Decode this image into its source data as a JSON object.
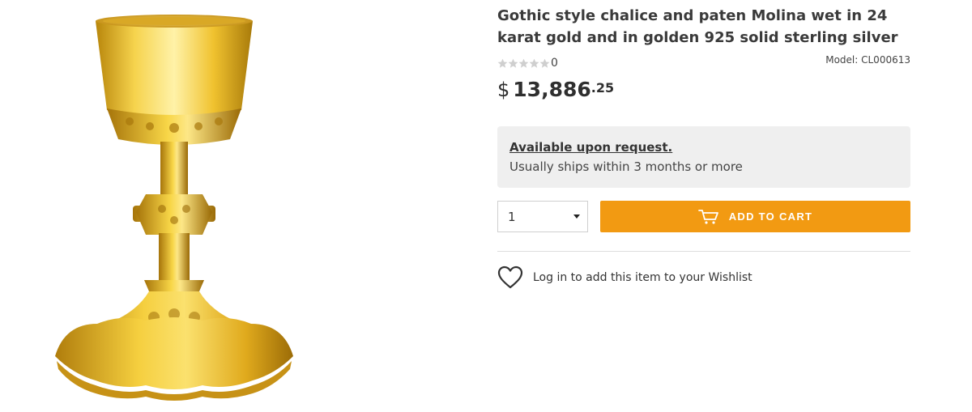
{
  "product": {
    "image_alt": "Gothic style chalice in gold",
    "title": "Gothic style chalice and paten Molina wet in 24 karat gold and in golden 925 solid sterling silver",
    "rating": {
      "stars": 0,
      "max": 5,
      "count": "0"
    },
    "model": "Model: CL000613",
    "price": {
      "currency": "$",
      "main": "13,886",
      "cents": ".25"
    }
  },
  "availability": {
    "title": "Available upon request.",
    "subtitle": "Usually ships within 3 months or more"
  },
  "quantity": {
    "value": "1"
  },
  "cart": {
    "button_label": "ADD TO CART",
    "icon": "cart-icon"
  },
  "wishlist": {
    "text": "Log in to add this item to your Wishlist",
    "icon": "heart-icon"
  },
  "colors": {
    "accent": "#f29a12",
    "availability_bg": "#efefef",
    "gold": "#e8b520"
  }
}
